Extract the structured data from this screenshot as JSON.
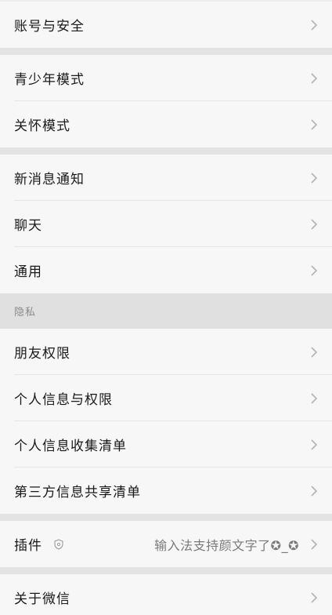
{
  "groups": [
    {
      "items": [
        {
          "label": "账号与安全"
        }
      ]
    },
    {
      "items": [
        {
          "label": "青少年模式"
        },
        {
          "label": "关怀模式"
        }
      ]
    },
    {
      "items": [
        {
          "label": "新消息通知"
        },
        {
          "label": "聊天"
        },
        {
          "label": "通用"
        }
      ]
    }
  ],
  "privacy": {
    "header": "隐私",
    "items": [
      {
        "label": "朋友权限"
      },
      {
        "label": "个人信息与权限"
      },
      {
        "label": "个人信息收集清单"
      },
      {
        "label": "第三方信息共享清单"
      }
    ]
  },
  "plugins": {
    "label": "插件",
    "value": "输入法支持颜文字了✪_✪",
    "icon": "shield-icon"
  },
  "about": {
    "label": "关于微信"
  },
  "icons": {
    "chevron": "chevron-right-icon"
  },
  "colors": {
    "background": "#ededed",
    "row": "#f7f7f7",
    "text": "#1a1a1a",
    "secondary": "#8a8a8a",
    "chevron": "#b3b3b3"
  }
}
